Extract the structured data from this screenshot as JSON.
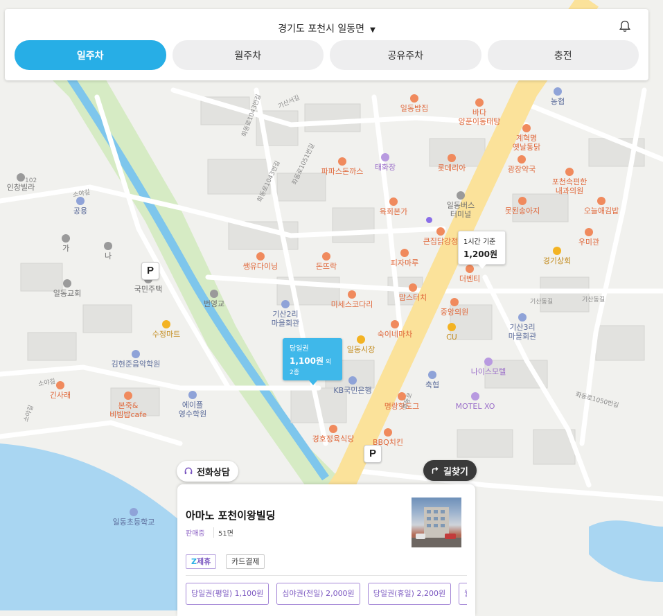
{
  "header": {
    "location": "경기도 포천시 일동면",
    "tabs": [
      {
        "label": "일주차",
        "active": true
      },
      {
        "label": "월주차",
        "active": false
      },
      {
        "label": "공유주차",
        "active": false
      },
      {
        "label": "충전",
        "active": false
      }
    ]
  },
  "map": {
    "pois": [
      {
        "label": "일동밥집",
        "style": "orange"
      },
      {
        "label": "바다\n양푼이동태탕",
        "style": "orange"
      },
      {
        "label": "계혁명\n옛날통닭",
        "style": "orange"
      },
      {
        "label": "농협",
        "style": "blue"
      },
      {
        "label": "광장약국",
        "style": "orange"
      },
      {
        "label": "포천속편한\n내과의원",
        "style": "orange"
      },
      {
        "label": "오늘애김밥",
        "style": "orange"
      },
      {
        "label": "우미관",
        "style": "orange"
      },
      {
        "label": "파파스돈까스",
        "style": "orange"
      },
      {
        "label": "태화장",
        "style": "purple"
      },
      {
        "label": "롯데리아",
        "style": "orange"
      },
      {
        "label": "육회본가",
        "style": "orange"
      },
      {
        "label": "일동버스\n터미널",
        "style": "gray"
      },
      {
        "label": "못된송아지",
        "style": "orange"
      },
      {
        "label": "큰집닭강정",
        "style": "orange"
      },
      {
        "label": "경기상회",
        "style": "gold"
      },
      {
        "label": "쌩유다이닝",
        "style": "orange"
      },
      {
        "label": "돈뜨락",
        "style": "orange"
      },
      {
        "label": "피자마루",
        "style": "orange"
      },
      {
        "label": "더벤티",
        "style": "orange"
      },
      {
        "label": "미세스코다리",
        "style": "orange"
      },
      {
        "label": "맘스터치",
        "style": "orange"
      },
      {
        "label": "중앙의원",
        "style": "orange"
      },
      {
        "label": "기산2리\n마을회관",
        "style": "blue"
      },
      {
        "label": "숙이네마차",
        "style": "orange"
      },
      {
        "label": "CU",
        "style": "gold"
      },
      {
        "label": "기산3리\n마을회관",
        "style": "blue"
      },
      {
        "label": "일동시장",
        "style": "gold"
      },
      {
        "label": "나이스모텔",
        "style": "purple"
      },
      {
        "label": "KB국민은행",
        "style": "blue"
      },
      {
        "label": "축협",
        "style": "blue"
      },
      {
        "label": "MOTEL XO",
        "style": "purple"
      },
      {
        "label": "명랑핫도그",
        "style": "orange"
      },
      {
        "label": "경호정육식당",
        "style": "orange"
      },
      {
        "label": "BBQ치킨",
        "style": "orange"
      },
      {
        "label": "공용",
        "style": "blue"
      },
      {
        "label": "인창빌라",
        "style": "gray"
      },
      {
        "label": "일동교회",
        "style": "gray"
      },
      {
        "label": "국민주택",
        "style": "gray"
      },
      {
        "label": "수정마트",
        "style": "gold"
      },
      {
        "label": "김현준음악학원",
        "style": "blue"
      },
      {
        "label": "긴사래",
        "style": "orange"
      },
      {
        "label": "본죽&\n비빔밥cafe",
        "style": "orange"
      },
      {
        "label": "에이플\n영수학원",
        "style": "blue"
      },
      {
        "label": "일동초등학교",
        "style": "blue"
      },
      {
        "label": "번영교",
        "style": "gray"
      },
      {
        "label": "가",
        "style": "gray"
      },
      {
        "label": "나",
        "style": "gray"
      }
    ],
    "roads": [
      "기산서길",
      "화동로1043번길",
      "화동로1051번길",
      "화동로1043번길",
      "소야길",
      "기산동길",
      "화동로",
      "화동로1050번길",
      "소야길",
      "소야길",
      "102",
      "기산동길"
    ],
    "parking_marker_label": "P",
    "bubbles": [
      {
        "line1": "당일권",
        "line2": "1,100원",
        "extra": "외 2종",
        "selected": true
      },
      {
        "line1": "1시간 기준",
        "line2": "1,200원",
        "extra": "",
        "selected": false
      }
    ]
  },
  "actions": {
    "call_label": "전화상담",
    "directions_label": "길찾기"
  },
  "card": {
    "title": "아마노 포천이왕빌딩",
    "status": "판매중",
    "spaces": "51면",
    "tags": [
      "제휴",
      "카드결제"
    ],
    "tickets": [
      "당일권(평일) 1,100원",
      "심야권(전일) 2,000원",
      "당일권(휴일) 2,200원",
      "월"
    ]
  },
  "colors": {
    "accent": "#27aee6",
    "purple": "#7a56c0",
    "road_main": "#fbe29a",
    "river": "#7ec6ec",
    "park": "#cfe8b8"
  }
}
